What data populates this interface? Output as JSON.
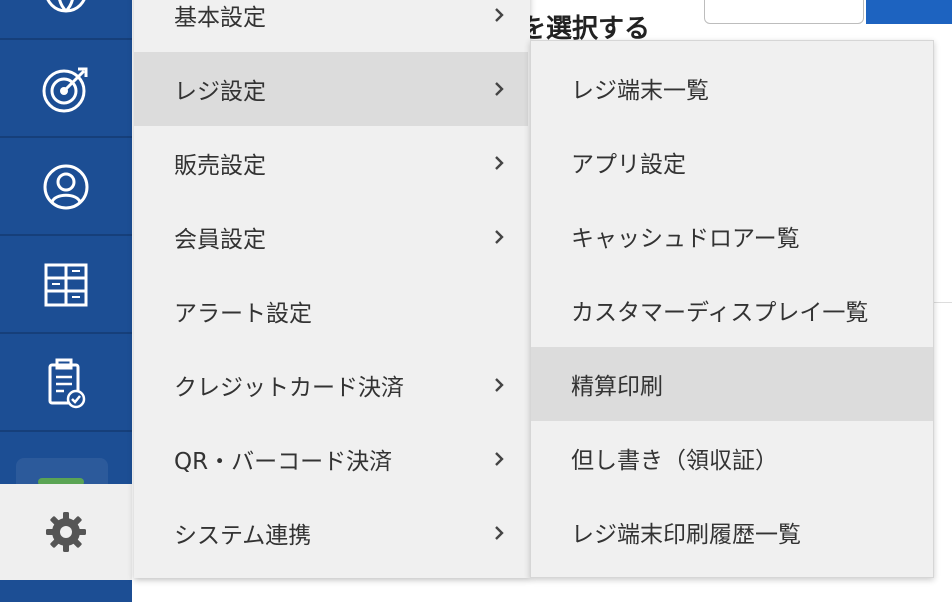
{
  "colors": {
    "sidebar": "#1c4e94",
    "menu_background": "#f0f0f0",
    "menu_active": "#dcdcdc",
    "text": "#333333"
  },
  "sidebar": {
    "icons": [
      "globe-icon",
      "target-icon",
      "user-icon",
      "grid-icon",
      "clipboard-check-icon",
      "gear-icon"
    ]
  },
  "background": {
    "heading": "を選択する"
  },
  "main_menu": {
    "items": [
      {
        "label": "基本設定",
        "has_submenu": true
      },
      {
        "label": "レジ設定",
        "has_submenu": true,
        "active": true
      },
      {
        "label": "販売設定",
        "has_submenu": true
      },
      {
        "label": "会員設定",
        "has_submenu": true
      },
      {
        "label": "アラート設定",
        "has_submenu": false
      },
      {
        "label": "クレジットカード決済",
        "has_submenu": true
      },
      {
        "label": "QR・バーコード決済",
        "has_submenu": true
      },
      {
        "label": "システム連携",
        "has_submenu": true
      }
    ]
  },
  "sub_menu": {
    "items": [
      {
        "label": "レジ端末一覧"
      },
      {
        "label": "アプリ設定"
      },
      {
        "label": "キャッシュドロアー覧"
      },
      {
        "label": "カスタマーディスプレイ一覧"
      },
      {
        "label": "精算印刷",
        "active": true
      },
      {
        "label": "但し書き（領収証）"
      },
      {
        "label": "レジ端末印刷履歴一覧"
      }
    ]
  }
}
